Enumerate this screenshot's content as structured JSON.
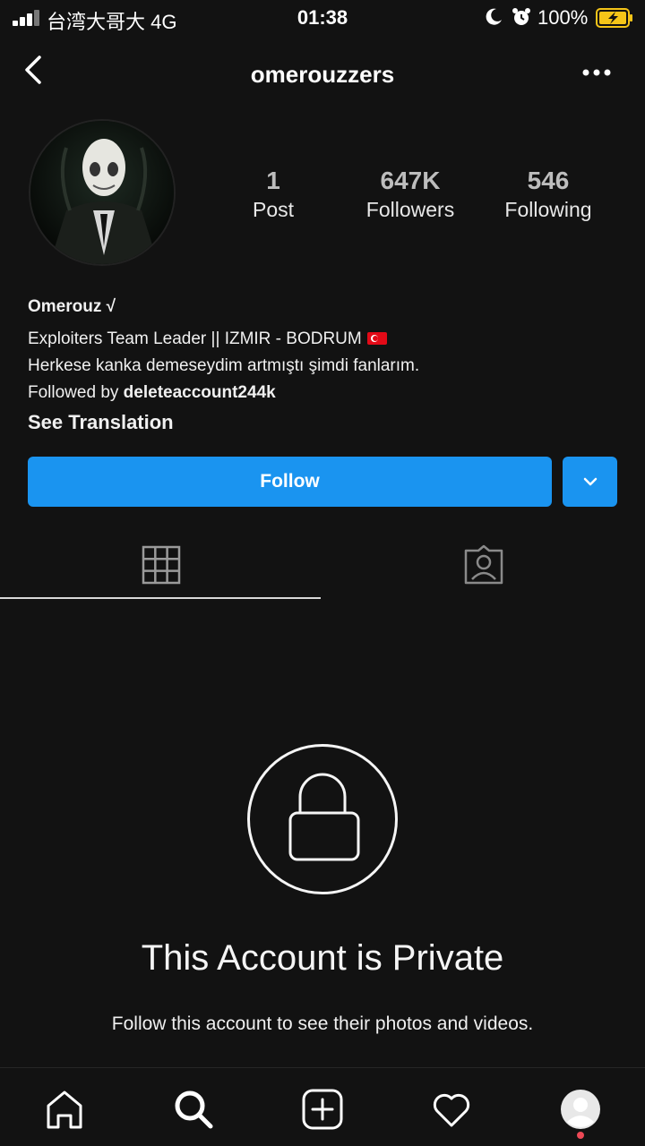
{
  "status_bar": {
    "carrier": "台湾大哥大  4G",
    "time": "01:38",
    "battery": "100%"
  },
  "header": {
    "username": "omerouzzers"
  },
  "stats": [
    {
      "value": "1",
      "label": "Post"
    },
    {
      "value": "647K",
      "label": "Followers"
    },
    {
      "value": "546",
      "label": "Following"
    }
  ],
  "bio": {
    "name": "Omerouz √",
    "line1": "Exploiters Team Leader || IZMIR - BODRUM",
    "line2": "Herkese kanka demeseydim artmıştı şimdi fanlarım.",
    "followed_by_prefix": "Followed by ",
    "followed_by_user": "deleteaccount244k",
    "see_translation": "See Translation"
  },
  "actions": {
    "follow_label": "Follow"
  },
  "private": {
    "title": "This Account is Private",
    "subtitle": "Follow this account to see their photos and videos."
  },
  "colors": {
    "background": "#121212",
    "accent": "#1a94f0",
    "notification": "#ed4956"
  }
}
